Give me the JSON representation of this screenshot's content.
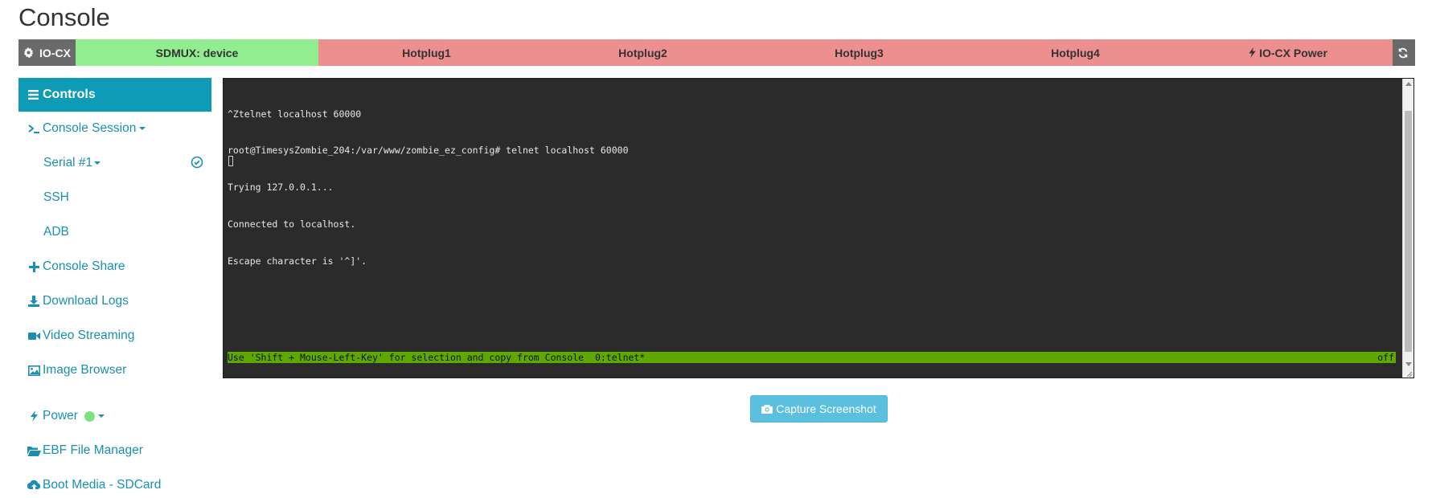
{
  "page": {
    "title": "Console"
  },
  "status_bar": {
    "iocx_label": "IO-CX",
    "sdmux_label": "SDMUX: device",
    "hotplugs": [
      "Hotplug1",
      "Hotplug2",
      "Hotplug3",
      "Hotplug4"
    ],
    "power_label": "IO-CX Power",
    "colors": {
      "gray": "#6a6a6a",
      "green": "#90ee90",
      "red": "#ee8f8f"
    }
  },
  "sidebar": {
    "header_label": "Controls",
    "console_session_label": "Console Session",
    "serial_label": "Serial #1",
    "ssh_label": "SSH",
    "adb_label": "ADB",
    "console_share_label": "Console Share",
    "download_logs_label": "Download Logs",
    "video_streaming_label": "Video Streaming",
    "image_browser_label": "Image Browser",
    "power_label": "Power",
    "ebf_label": "EBF File Manager",
    "boot_media_label": "Boot Media - SDCard",
    "accent_color": "#0e9bb5"
  },
  "terminal": {
    "lines": [
      "^Ztelnet localhost 60000",
      "root@TimesysZombie_204:/var/www/zombie_ez_config# telnet localhost 60000",
      "Trying 127.0.0.1...",
      "Connected to localhost.",
      "Escape character is '^]'."
    ],
    "status_left": "Use 'Shift + Mouse-Left-Key' for selection and copy from Console  0:telnet*",
    "status_right": "off"
  },
  "capture_button": {
    "label": "Capture Screenshot"
  }
}
